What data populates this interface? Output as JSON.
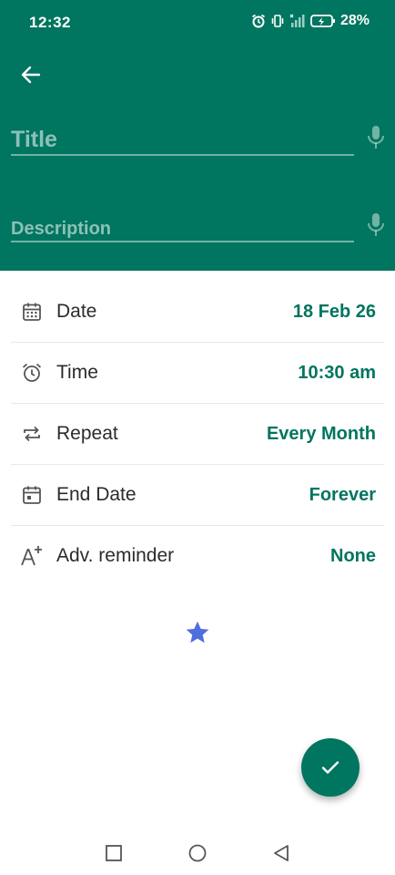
{
  "status": {
    "time": "12:32",
    "battery": "28%"
  },
  "form": {
    "title_placeholder": "Title",
    "description_placeholder": "Description"
  },
  "rows": [
    {
      "label": "Date",
      "value": "18 Feb 26",
      "icon": "calendar-icon"
    },
    {
      "label": "Time",
      "value": "10:30 am",
      "icon": "alarm-clock-icon"
    },
    {
      "label": "Repeat",
      "value": "Every Month",
      "icon": "repeat-icon"
    },
    {
      "label": "End Date",
      "value": "Forever",
      "icon": "calendar-event-icon"
    },
    {
      "label": "Adv. reminder",
      "value": "None",
      "icon": "text-plus-icon"
    }
  ],
  "colors": {
    "primary": "#00755f",
    "star": "#4f6fdf",
    "text": "#2b2b2b"
  }
}
